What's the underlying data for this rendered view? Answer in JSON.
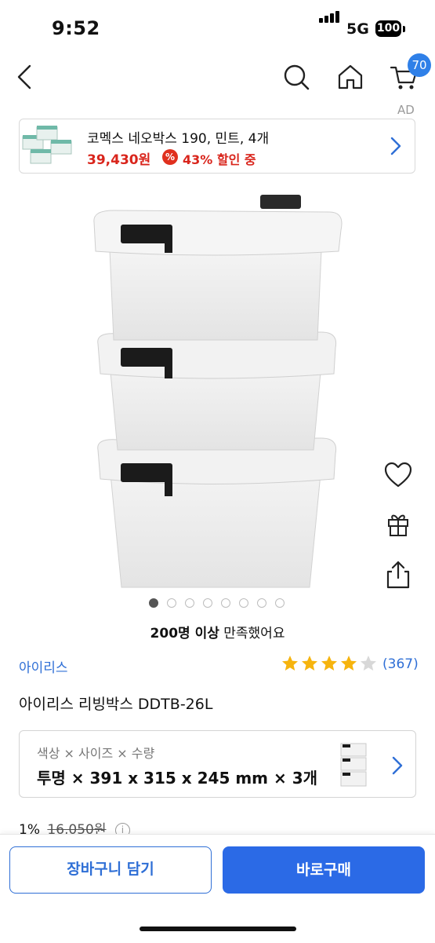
{
  "status_bar": {
    "time": "9:52",
    "network": "5G",
    "battery": "100"
  },
  "nav": {
    "cart_count": "70",
    "ad_label": "AD"
  },
  "ad": {
    "title": "코멕스 네오박스 190, 민트, 4개",
    "price": "39,430원",
    "discount_icon": "%",
    "discount": "43% 할인 중"
  },
  "gallery": {
    "dots": 8,
    "active_index": 0
  },
  "satisfaction": {
    "highlight": "200명 이상",
    "text": " 만족했어요"
  },
  "product": {
    "brand": "아이리스",
    "rating": 4,
    "rating_max": 5,
    "review_count": "(367)",
    "name": "아이리스 리빙박스 DDTB-26L"
  },
  "option": {
    "label": "색상 × 사이즈 × 수량",
    "value": "투명 × 391 x 315 x 245 mm × 3개"
  },
  "price": {
    "discount_rate": "1%",
    "original": "16,050원",
    "info_icon": "i"
  },
  "actions": {
    "cart_button": "장바구니 담기",
    "buy_button": "바로구매"
  },
  "colors": {
    "accent": "#2b6ae6",
    "link": "#2f6fd6",
    "sale": "#d9251c",
    "star": "#f6b40e"
  }
}
